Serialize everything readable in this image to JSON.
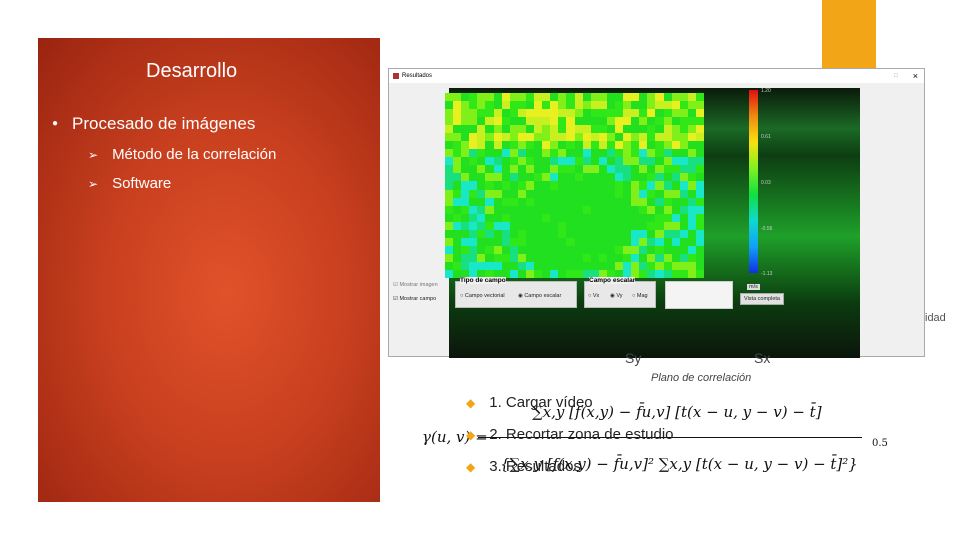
{
  "slide": {
    "title": "Desarrollo",
    "bullet": "Procesado de imágenes",
    "subbullets": [
      "Método de la correlación",
      "Software"
    ],
    "steps": [
      "1. Cargar vídeo",
      "2. Recortar zona de estudio",
      "3. Resultados"
    ],
    "figure_labels": {
      "sy": "Sy",
      "sx": "Sx",
      "caption": "Plano de correlación"
    },
    "partial_text": "idad",
    "formula": {
      "lhs": "γ(u, v) =",
      "numerator": "∑x,y [f(x,y) − f̄u,v] [t(x − u, y − v) − t̄]",
      "denominator": "{∑x,y [f(x,y) − f̄u,v]² ∑x,y [t(x − u, y − v) − t̄]²}",
      "exponent": "0.5"
    },
    "colors": {
      "accent": "#f2a516",
      "panel": "#c9401f"
    }
  },
  "window": {
    "title": "Resultados",
    "close": "×",
    "maximize": "□",
    "colorbar": {
      "ticks": [
        "1.20",
        "0.61",
        "0.03",
        "-0.56",
        "-1.13"
      ],
      "unit": "m/s"
    },
    "checkboxes": [
      {
        "label": "Mostrar imagen",
        "checked": true
      },
      {
        "label": "Mostrar campo",
        "checked": true
      }
    ],
    "tipo_campo": {
      "title": "Tipo de campo",
      "options": [
        "Campo vectorial",
        "Campo escalar"
      ],
      "selected": "Campo escalar"
    },
    "campo_escalar": {
      "title": "Campo escalar",
      "options": [
        "Vx",
        "Vy",
        "Mag"
      ],
      "selected": "Vy"
    },
    "button": "Vista completa"
  }
}
